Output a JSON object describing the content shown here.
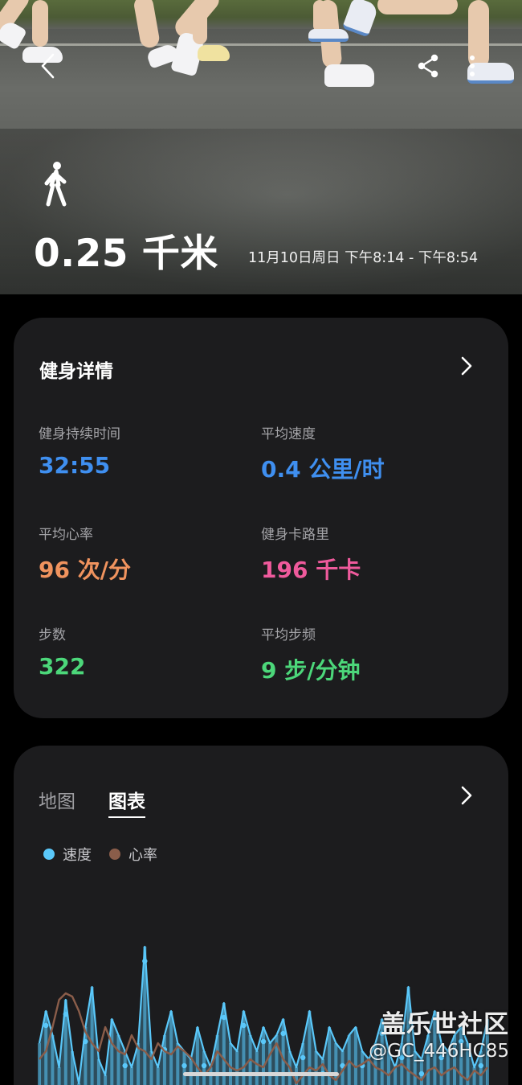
{
  "hero": {
    "distance": "0.25 千米",
    "time_range": "11月10日周日 下午8:14 - 下午8:54"
  },
  "icons": {
    "back": "chevron-left-icon",
    "share": "share-icon",
    "more": "more-vertical-icon",
    "activity": "walking-icon"
  },
  "details": {
    "title": "健身详情",
    "metrics": [
      {
        "label": "健身持续时间",
        "value": "32:55",
        "color": "#3f8ff0"
      },
      {
        "label": "平均速度",
        "value": "0.4 公里/时",
        "color": "#3f8ff0"
      },
      {
        "label": "平均心率",
        "value": "96 次/分",
        "color": "#f0935e"
      },
      {
        "label": "健身卡路里",
        "value": "196 千卡",
        "color": "#ef5a9c"
      },
      {
        "label": "步数",
        "value": "322",
        "color": "#4cd77a"
      },
      {
        "label": "平均步频",
        "value": "9 步/分钟",
        "color": "#4cd77a"
      }
    ]
  },
  "chart_section": {
    "tabs": [
      {
        "label": "地图",
        "active": false
      },
      {
        "label": "图表",
        "active": true
      }
    ],
    "legend": [
      {
        "label": "速度",
        "color": "#5ac8fa"
      },
      {
        "label": "心率",
        "color": "#8a5d4a"
      }
    ]
  },
  "chart_data": {
    "type": "line",
    "series": [
      {
        "name": "速度",
        "color": "#5ac8fa",
        "values": [
          0.35,
          0.55,
          0.4,
          0.2,
          0.62,
          0.3,
          0.1,
          0.45,
          0.7,
          0.25,
          0.15,
          0.5,
          0.4,
          0.3,
          0.2,
          0.35,
          0.95,
          0.3,
          0.2,
          0.4,
          0.55,
          0.35,
          0.3,
          0.25,
          0.45,
          0.3,
          0.2,
          0.4,
          0.6,
          0.35,
          0.3,
          0.55,
          0.4,
          0.3,
          0.45,
          0.35,
          0.4,
          0.5,
          0.3,
          0.2,
          0.35,
          0.55,
          0.3,
          0.25,
          0.45,
          0.35,
          0.3,
          0.4,
          0.45,
          0.3,
          0.25,
          0.35,
          0.5,
          0.3,
          0.2,
          0.35,
          0.7,
          0.3,
          0.25,
          0.4,
          0.55,
          0.35,
          0.3,
          0.4,
          0.45,
          0.35,
          0.2,
          0.3,
          0.5
        ]
      },
      {
        "name": "心率",
        "color": "#8a5d4a",
        "values": [
          0.25,
          0.3,
          0.45,
          0.62,
          0.66,
          0.64,
          0.55,
          0.42,
          0.35,
          0.3,
          0.45,
          0.35,
          0.3,
          0.28,
          0.4,
          0.32,
          0.3,
          0.25,
          0.35,
          0.3,
          0.28,
          0.33,
          0.3,
          0.26,
          0.2,
          0.15,
          0.2,
          0.3,
          0.25,
          0.2,
          0.18,
          0.2,
          0.25,
          0.22,
          0.2,
          0.28,
          0.35,
          0.25,
          0.2,
          0.1,
          0.15,
          0.2,
          0.18,
          0.22,
          0.15,
          0.12,
          0.18,
          0.24,
          0.2,
          0.22,
          0.25,
          0.2,
          0.18,
          0.15,
          0.2,
          0.22,
          0.18,
          0.15,
          0.12,
          0.18,
          0.2,
          0.15,
          0.18,
          0.2,
          0.15,
          0.12,
          0.18,
          0.15,
          0.2
        ]
      }
    ]
  },
  "watermark": {
    "line1": "盖乐世社区",
    "line2": "@GC_446HC85"
  }
}
